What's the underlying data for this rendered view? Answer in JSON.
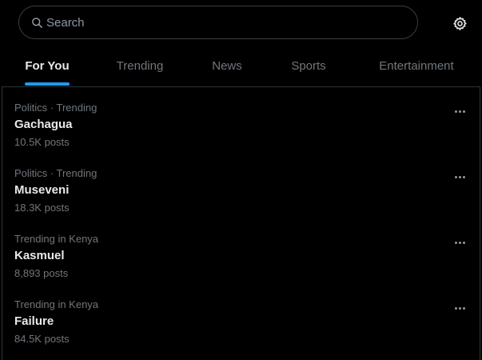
{
  "search": {
    "placeholder": "Search",
    "value": ""
  },
  "tabs": [
    {
      "label": "For You",
      "active": true
    },
    {
      "label": "Trending",
      "active": false
    },
    {
      "label": "News",
      "active": false
    },
    {
      "label": "Sports",
      "active": false
    },
    {
      "label": "Entertainment",
      "active": false
    }
  ],
  "trends": [
    {
      "meta": "Politics · Trending",
      "name": "Gachagua",
      "posts": "10.5K posts"
    },
    {
      "meta": "Politics · Trending",
      "name": "Museveni",
      "posts": "18.3K posts"
    },
    {
      "meta": "Trending in Kenya",
      "name": "Kasmuel",
      "posts": "8,893 posts"
    },
    {
      "meta": "Trending in Kenya",
      "name": "Failure",
      "posts": "84.5K posts"
    }
  ],
  "icons": {
    "search": "search-icon",
    "settings": "gear-icon",
    "more": "more-horizontal-icon"
  },
  "colors": {
    "background": "#000000",
    "primary_text": "#e7e9ea",
    "secondary_text": "#71767b",
    "accent": "#1d9bf0",
    "border": "#2f3336"
  }
}
